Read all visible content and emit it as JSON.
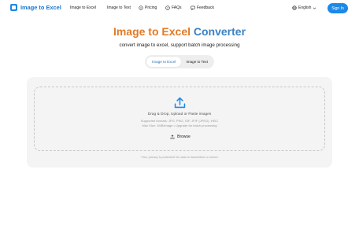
{
  "brand": {
    "name": "Image to Excel",
    "logo_icon": "table-logo-icon",
    "color": "#1976d2"
  },
  "nav": {
    "links": [
      {
        "label": "Image to Excel",
        "icon": ""
      },
      {
        "label": "Image to Text",
        "icon": ""
      },
      {
        "label": "Pricing",
        "icon": "tag-icon"
      },
      {
        "label": "FAQs",
        "icon": "help-circle-icon"
      },
      {
        "label": "Feedback",
        "icon": "message-icon"
      }
    ],
    "language": {
      "label": "English",
      "icon": "globe-icon"
    },
    "signin_label": "Sign In"
  },
  "hero": {
    "title_part1": "Image to Excel",
    "title_part2": "Converter",
    "subtitle": "convert image to excel, support batch image processing"
  },
  "modes": {
    "active": "Image to Excel",
    "options": [
      "Image to Excel",
      "Image to Text"
    ]
  },
  "upload": {
    "title": "Drag & Drop, Upload or Paste images",
    "formats": "Supported formats: JPG, PNG, GIF, JFIF (JPEG), HEIC",
    "size": "Max Size: 1MB/image • Upgrade for batch processing",
    "browse_label": "Browse",
    "privacy": "*Your privacy is protected! No data is transmitted or stored."
  },
  "colors": {
    "accent": "#1e88e5",
    "title_orange": "#e27a26",
    "title_blue": "#3b82c4",
    "card_bg": "#f4f4f5"
  }
}
